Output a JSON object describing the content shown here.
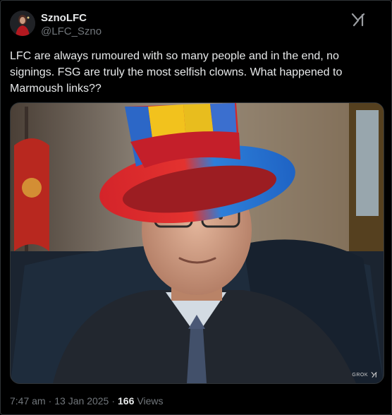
{
  "author": {
    "display_name": "SznoLFC",
    "handle": "@LFC_Szno"
  },
  "icons": {
    "logo": "x-logo-icon",
    "watermark": "grok-logo-icon"
  },
  "tweet": {
    "text": "LFC are always rumoured with so many people and in the end, no signings. FSG are truly the most selfish clowns. What happened to Marmoush links??"
  },
  "media": {
    "watermark_text": "GROK"
  },
  "meta": {
    "time": "7:47 am",
    "separator": "·",
    "date": "13 Jan 2025",
    "views_count": "166",
    "views_label": "Views"
  },
  "colors": {
    "background": "#000000",
    "text_primary": "#e7e9ea",
    "text_secondary": "#71767b",
    "border": "#2f3336"
  }
}
